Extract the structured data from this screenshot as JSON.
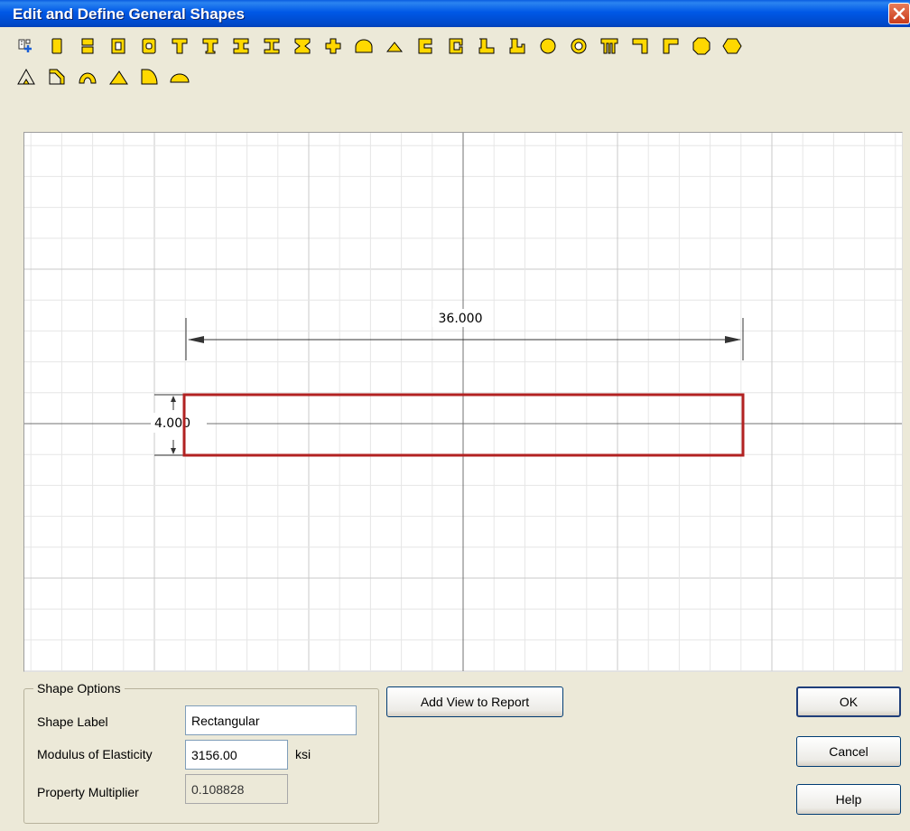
{
  "window": {
    "title": "Edit and Define General Shapes"
  },
  "toolbar": {
    "row1": [
      {
        "icon": "edit-shape-icon"
      },
      {
        "icon": "rectangle-shape-icon"
      },
      {
        "icon": "split-rectangle-shape-icon"
      },
      {
        "icon": "hollow-rectangle-shape-icon"
      },
      {
        "icon": "hollow-rounded-rectangle-shape-icon"
      },
      {
        "icon": "tee-shape-icon"
      },
      {
        "icon": "tee-flanged-shape-icon"
      },
      {
        "icon": "i-beam-shape-icon"
      },
      {
        "icon": "i-beam-flanged-shape-icon"
      },
      {
        "icon": "hourglass-i-shape-icon"
      },
      {
        "icon": "cross-shape-icon"
      },
      {
        "icon": "arch-shape-icon"
      },
      {
        "icon": "small-triangle-shape-icon"
      },
      {
        "icon": "channel-shape-icon"
      },
      {
        "icon": "channel-lipped-shape-icon"
      },
      {
        "icon": "z-shape-icon"
      },
      {
        "icon": "z-lipped-shape-icon"
      },
      {
        "icon": "circle-shape-icon"
      },
      {
        "icon": "ring-shape-icon"
      },
      {
        "icon": "double-tee-shape-icon"
      },
      {
        "icon": "l-right-shape-icon"
      },
      {
        "icon": "l-left-shape-icon"
      },
      {
        "icon": "octagon-shape-icon"
      },
      {
        "icon": "hexagon-shape-icon"
      }
    ],
    "row2": [
      {
        "icon": "right-triangle-outline-shape-icon"
      },
      {
        "icon": "corner-outline-shape-icon"
      },
      {
        "icon": "curved-arch-shape-icon"
      },
      {
        "icon": "triangle-shape-icon"
      },
      {
        "icon": "quarter-round-shape-icon"
      },
      {
        "icon": "half-round-shape-icon"
      }
    ]
  },
  "canvas": {
    "width_dimension": "36.000",
    "height_dimension": "4.000",
    "shape_color": "#b22222",
    "grid_color": "#e6e6e6",
    "axis_color": "#707070"
  },
  "shape_options": {
    "legend": "Shape Options",
    "shape_label_label": "Shape Label",
    "shape_label_value": "Rectangular",
    "modulus_label": "Modulus of Elasticity",
    "modulus_value": "3156.00",
    "modulus_unit": "ksi",
    "multiplier_label": "Property Multiplier",
    "multiplier_value": "0.108828"
  },
  "buttons": {
    "add_view": "Add View to Report",
    "ok": "OK",
    "cancel": "Cancel",
    "help": "Help"
  }
}
